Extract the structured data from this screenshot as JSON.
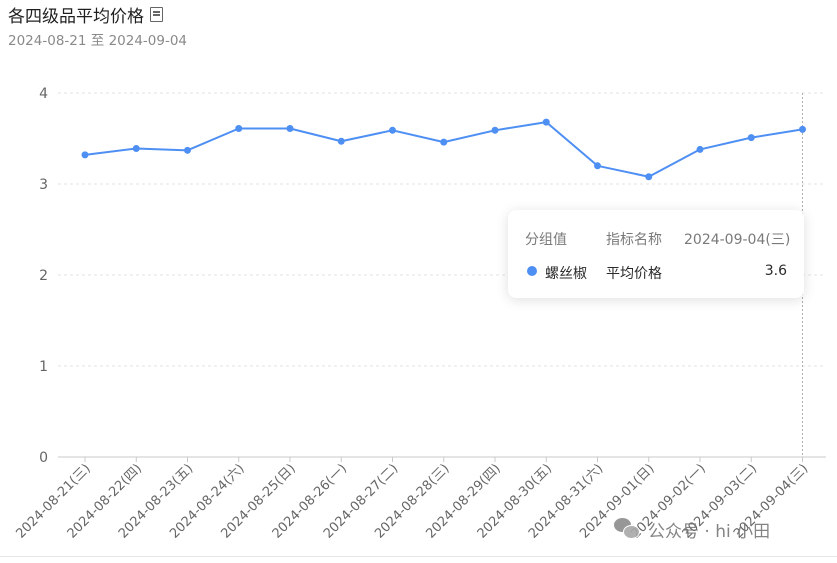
{
  "header": {
    "title": "各四级品平均价格",
    "title_icon": "document-icon",
    "date_from": "2024-08-21",
    "date_sep": "至",
    "date_to": "2024-09-04"
  },
  "tooltip": {
    "col_group": "分组值",
    "col_metric": "指标名称",
    "col_date": "2024-09-04(三)",
    "row_group": "螺丝椒",
    "row_metric": "平均价格",
    "row_value": "3.6"
  },
  "watermark": {
    "text": "公众号 · hi 小田"
  },
  "colors": {
    "series": "#4e8ff3",
    "grid": "#e3e3e3",
    "axis_text": "#666666"
  },
  "chart_data": {
    "type": "line",
    "title": "各四级品平均价格",
    "xlabel": "",
    "ylabel": "",
    "ylim": [
      0,
      4
    ],
    "yticks": [
      0,
      1,
      2,
      3,
      4
    ],
    "grid": true,
    "categories": [
      "2024-08-21(三)",
      "2024-08-22(四)",
      "2024-08-23(五)",
      "2024-08-24(六)",
      "2024-08-25(日)",
      "2024-08-26(一)",
      "2024-08-27(二)",
      "2024-08-28(三)",
      "2024-08-29(四)",
      "2024-08-30(五)",
      "2024-08-31(六)",
      "2024-09-01(日)",
      "2024-09-02(一)",
      "2024-09-03(二)",
      "2024-09-04(三)"
    ],
    "series": [
      {
        "name": "螺丝椒",
        "values": [
          3.32,
          3.39,
          3.37,
          3.61,
          3.61,
          3.47,
          3.59,
          3.46,
          3.59,
          3.68,
          3.2,
          3.08,
          3.38,
          3.51,
          3.6
        ]
      }
    ],
    "highlight_index": 14
  }
}
